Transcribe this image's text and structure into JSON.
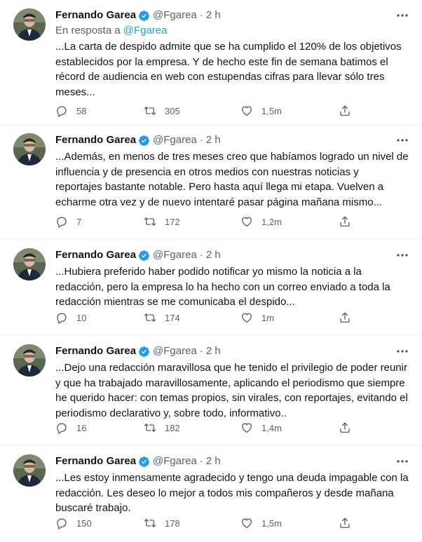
{
  "tweets": [
    {
      "name": "Fernando Garea",
      "handle": "@Fgarea",
      "dot": "·",
      "time": "2 h",
      "reply_prefix": "En resposta a ",
      "reply_handle": "@Fgarea",
      "text": "...La carta de despido admite que se ha cumplido el 120% de los objetivos\nestablecidos por la empresa. Y de hecho este fin de semana batimos el\nrécord de audiencia en web con estupendas cifras para llevar sólo tres\nmeses...",
      "replies": "58",
      "retweets": "305",
      "likes": "1,5m"
    },
    {
      "name": "Fernando Garea",
      "handle": "@Fgarea",
      "dot": "·",
      "time": "2 h",
      "text": "...Además, en menos de tres meses creo que habíamos logrado un nivel de\ninfluencia y de presencia en otros medios con nuestras noticias y\nreportajes bastante notable. Pero hasta aquí llega mi etapa. Vuelven a\necharme otra vez y de nuevo intentaré pasar página mañana mismo...",
      "replies": "7",
      "retweets": "172",
      "likes": "1,2m"
    },
    {
      "name": "Fernando Garea",
      "handle": "@Fgarea",
      "dot": "·",
      "time": "2 h",
      "text": "...Hubiera preferido haber podido notificar yo mismo la noticia a la\nredacción, pero la empresa lo ha hecho con un correo enviado a toda la\nredacción mientras se me comunicaba el despido...",
      "replies": "10",
      "retweets": "174",
      "likes": "1m"
    },
    {
      "name": "Fernando Garea",
      "handle": "@Fgarea",
      "dot": "·",
      "time": "2 h",
      "text": "...Dejo una redacción maravillosa que he tenido el privilegio de poder reunir\ny que ha trabajado maravillosamente, aplicando el periodismo que siempre\nhe querido hacer: con temas propios, sin virales, con reportajes, evitando el\nperiodismo declarativo y, sobre todo, informativo..",
      "replies": "16",
      "retweets": "182",
      "likes": "1,4m"
    },
    {
      "name": "Fernando Garea",
      "handle": "@Fgarea",
      "dot": "·",
      "time": "2 h",
      "text": "...Les estoy inmensamente agradecido y tengo una deuda impagable con la\nredacción. Les deseo lo mejor a todos mis compañeros y desde mañana\nbuscaré trabajo.",
      "replies": "150",
      "retweets": "178",
      "likes": "1,5m"
    }
  ],
  "colors": {
    "accent": "#1d9bf0",
    "secondary": "#536471",
    "text": "#0f1419"
  },
  "icons": [
    "verified-badge-icon",
    "more-icon",
    "reply-icon",
    "retweet-icon",
    "like-icon",
    "share-icon"
  ]
}
